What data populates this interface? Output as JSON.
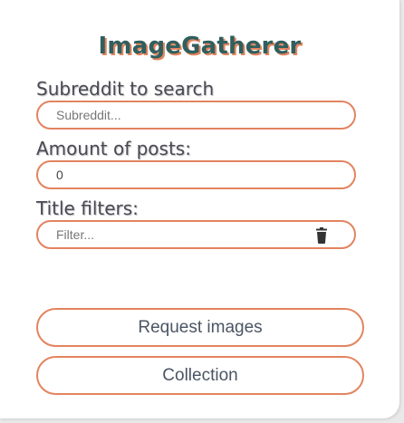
{
  "app": {
    "title": "ImageGatherer"
  },
  "form": {
    "subreddit_label": "Subreddit to search",
    "subreddit_placeholder": "Subreddit...",
    "subreddit_value": "",
    "amount_label": "Amount of posts:",
    "amount_value": "0",
    "filters_label": "Title filters:",
    "filter_placeholder": "Filter...",
    "filter_value": "",
    "delete_filter_icon": "trash-icon"
  },
  "actions": {
    "request_label": "Request images",
    "collection_label": "Collection"
  },
  "colors": {
    "accent": "#e2845f",
    "title": "#2f5f5e",
    "text": "#4a4a55"
  }
}
